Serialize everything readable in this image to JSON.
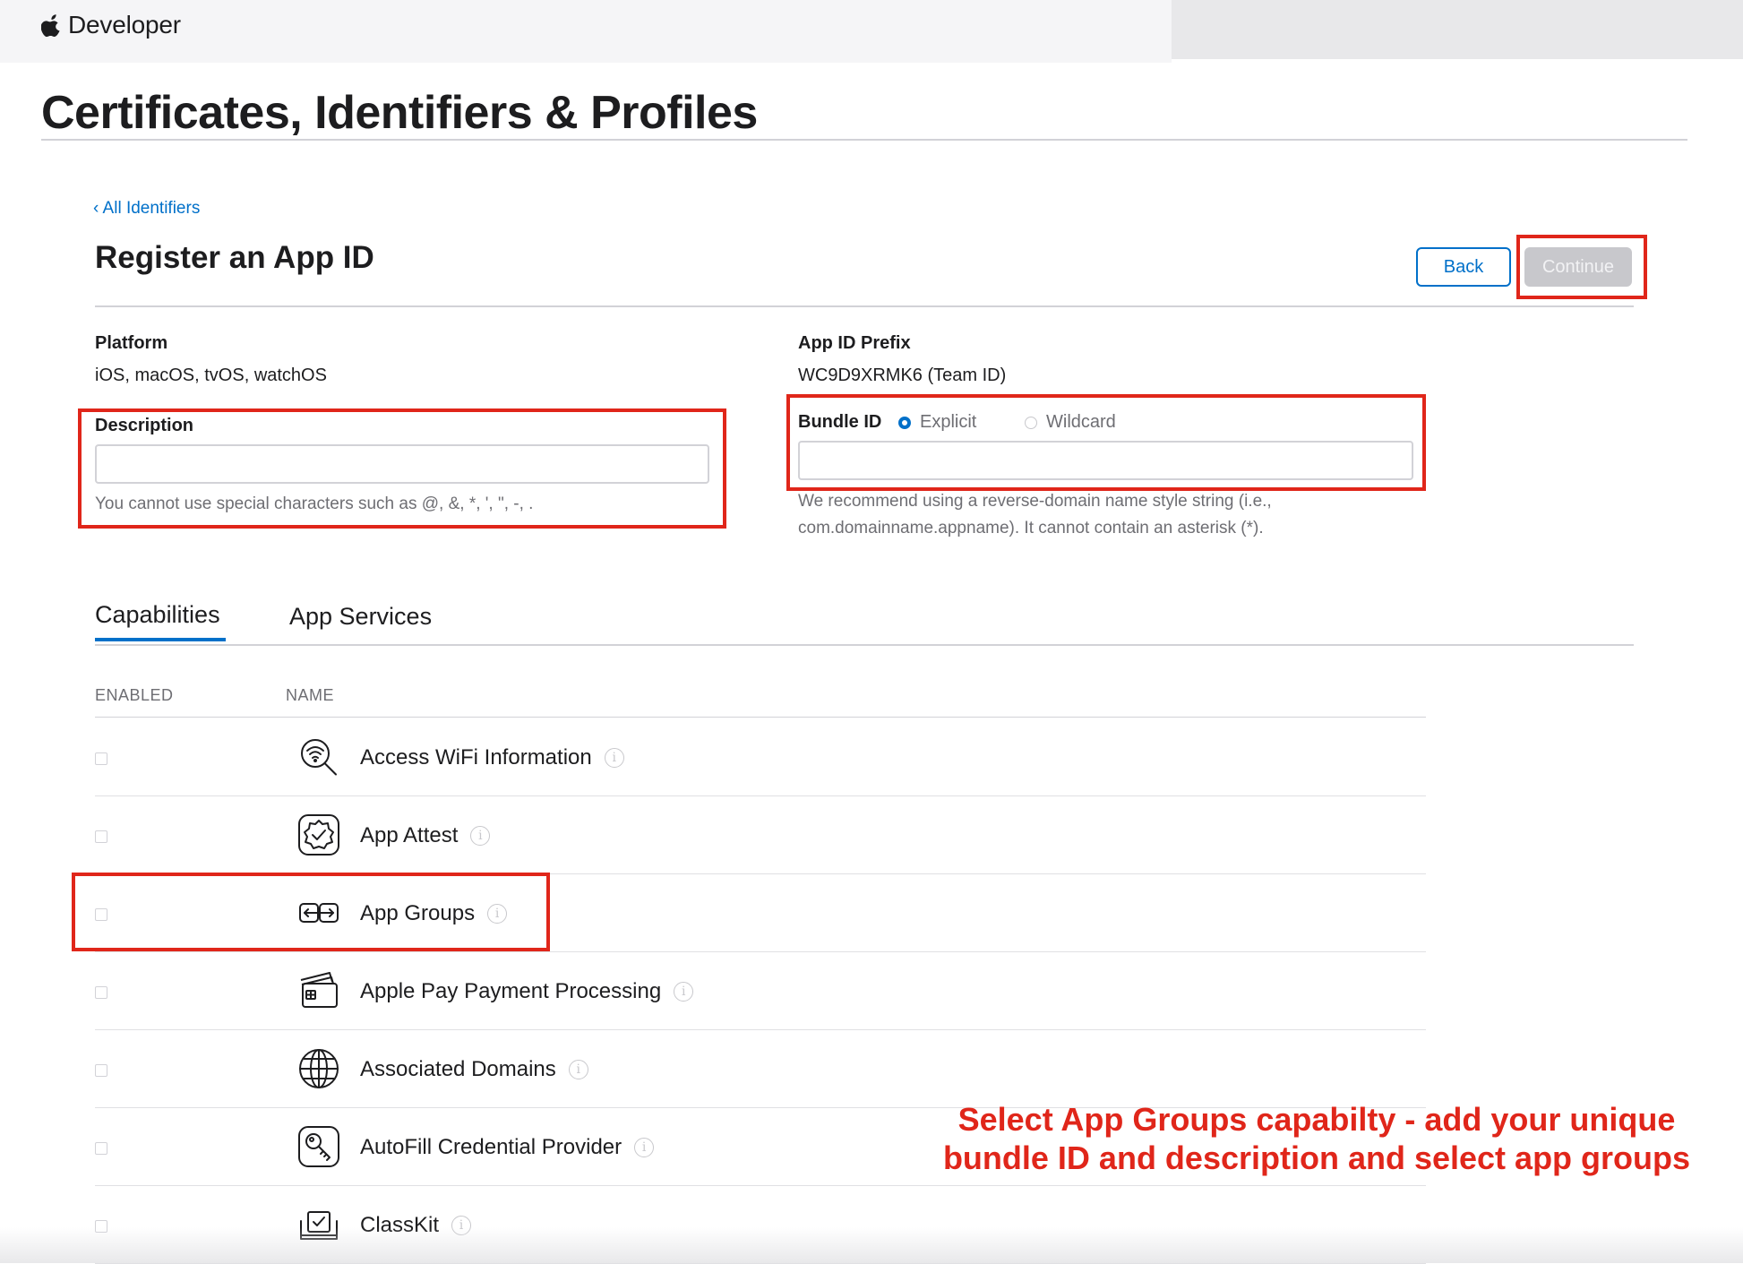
{
  "nav": {
    "brand": "Developer"
  },
  "page_title": "Certificates, Identifiers & Profiles",
  "back_link": "‹ All Identifiers",
  "section_title": "Register an App ID",
  "buttons": {
    "back": "Back",
    "continue": "Continue"
  },
  "platform": {
    "label": "Platform",
    "value": "iOS, macOS, tvOS, watchOS"
  },
  "prefix": {
    "label": "App ID Prefix",
    "value": "WC9D9XRMK6 (Team ID)"
  },
  "description": {
    "label": "Description",
    "value": "",
    "help": "You cannot use special characters such as @, &, *, ', \", -, ."
  },
  "bundle_id": {
    "label": "Bundle ID",
    "options": [
      "Explicit",
      "Wildcard"
    ],
    "selected": "Explicit",
    "value": "",
    "help_line1": "We recommend using a reverse-domain name style string (i.e.,",
    "help_line2": "com.domainname.appname). It cannot contain an asterisk (*)."
  },
  "tabs": [
    {
      "label": "Capabilities",
      "active": true
    },
    {
      "label": "App Services",
      "active": false
    }
  ],
  "table": {
    "headers": {
      "enabled": "ENABLED",
      "name": "NAME"
    },
    "rows": [
      {
        "name": "Access WiFi Information",
        "icon": "wifi-search-icon",
        "enabled": false
      },
      {
        "name": "App Attest",
        "icon": "checkmark-badge-icon",
        "enabled": false
      },
      {
        "name": "App Groups",
        "icon": "app-groups-arrows-icon",
        "enabled": false
      },
      {
        "name": "Apple Pay Payment Processing",
        "icon": "payment-cards-icon",
        "enabled": false
      },
      {
        "name": "Associated Domains",
        "icon": "globe-icon",
        "enabled": false
      },
      {
        "name": "AutoFill Credential Provider",
        "icon": "key-icon",
        "enabled": false
      },
      {
        "name": "ClassKit",
        "icon": "classkit-tray-icon",
        "enabled": false
      }
    ]
  },
  "annotation": {
    "line1": "Select App Groups capabilty - add your unique",
    "line2": "bundle ID and description and select app groups"
  },
  "colors": {
    "link": "#0070c9",
    "highlight": "#e0261a",
    "text": "#1d1d1f",
    "muted": "#6e6e73"
  }
}
